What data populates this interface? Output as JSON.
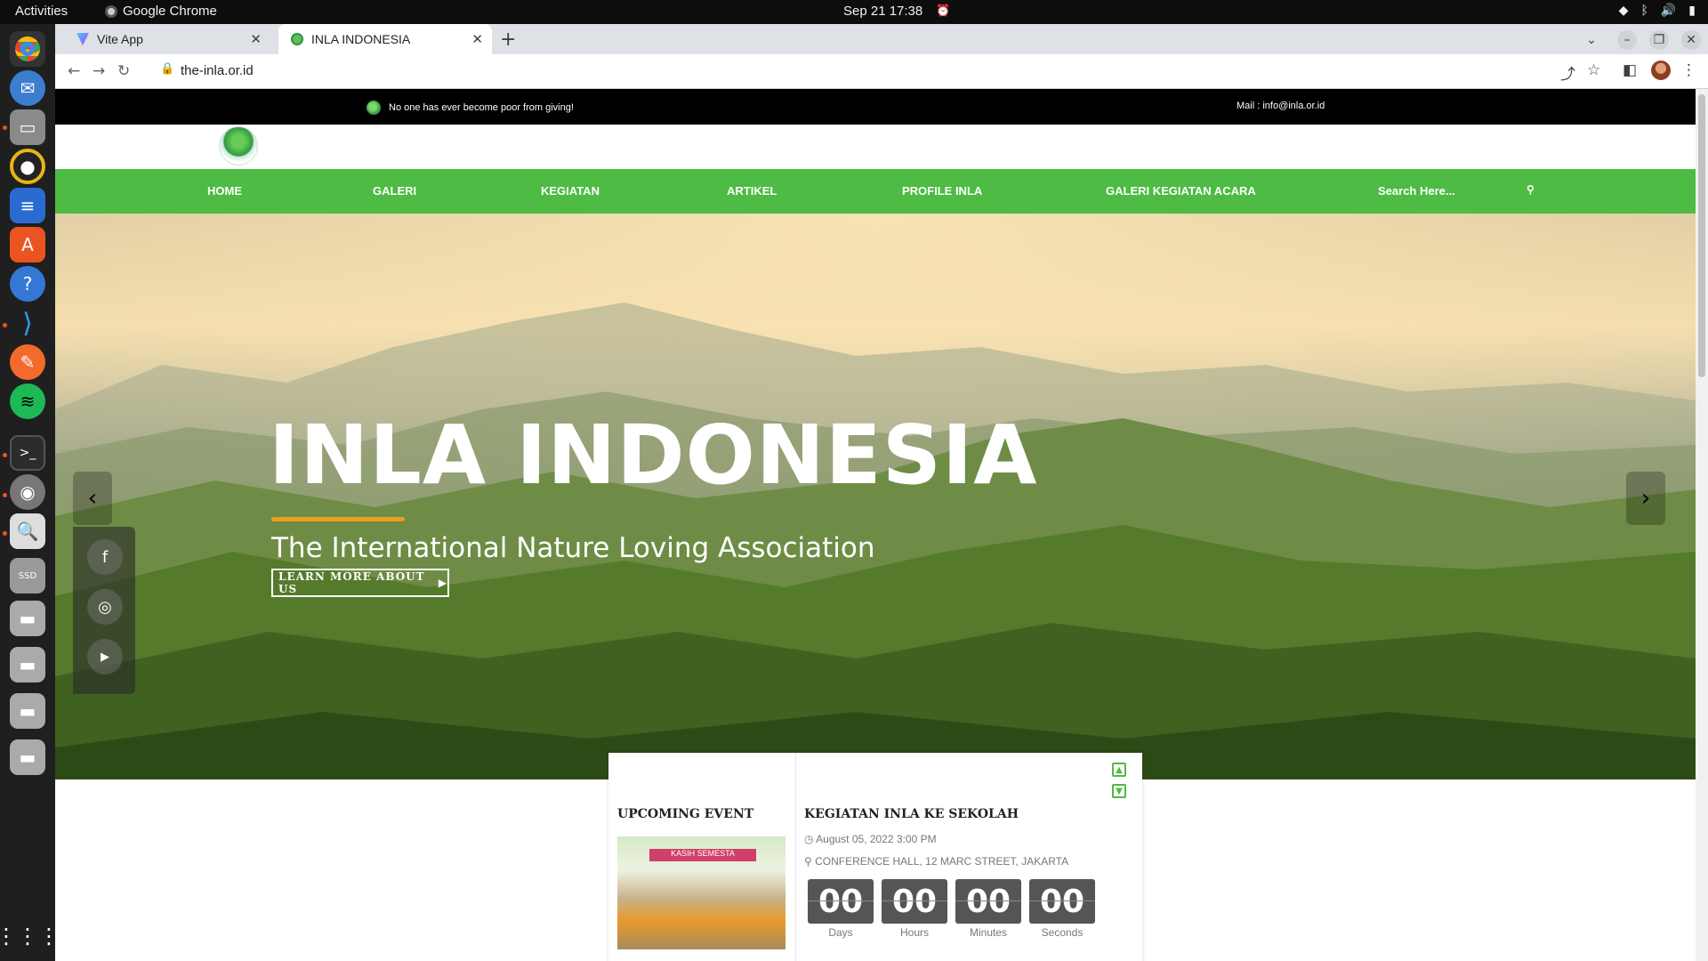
{
  "system": {
    "activities": "Activities",
    "app_name": "Google Chrome",
    "clock": "Sep 21  17:38"
  },
  "browser": {
    "tabs": [
      {
        "title": "Vite App"
      },
      {
        "title": "INLA INDONESIA"
      }
    ],
    "url": "the-inla.or.id"
  },
  "site": {
    "slogan": "No one has ever become poor from giving!",
    "mail": "Mail : info@inla.or.id",
    "nav": [
      "HOME",
      "GALERI",
      "KEGIATAN",
      "ARTIKEL",
      "PROFILE INLA",
      "GALERI KEGIATAN ACARA"
    ],
    "search_placeholder": "Search Here...",
    "hero": {
      "title": "INLA INDONESIA",
      "subtitle": "The International Nature Loving Association",
      "button": "LEARN MORE ABOUT US"
    },
    "upcoming": {
      "heading": "UPCOMING EVENT",
      "thumb_banner": "KASIH SEMESTA",
      "event_title": "KEGIATAN INLA KE SEKOLAH",
      "date": "August 05, 2022 3:00 PM",
      "location": "CONFERENCE HALL, 12 MARC STREET, JAKARTA",
      "countdown": [
        {
          "value": "00",
          "label": "Days"
        },
        {
          "value": "00",
          "label": "Hours"
        },
        {
          "value": "00",
          "label": "Minutes"
        },
        {
          "value": "00",
          "label": "Seconds"
        }
      ]
    }
  },
  "icons": {
    "prev": "‹",
    "next": "›",
    "facebook": "f",
    "instagram": "◎",
    "youtube": "▶"
  }
}
